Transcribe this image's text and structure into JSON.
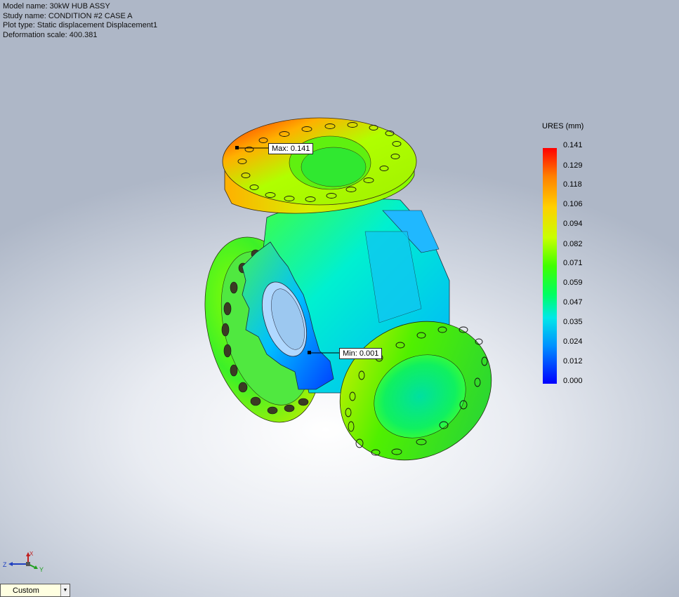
{
  "info": {
    "model_name": "Model name: 30kW HUB ASSY",
    "study_name": "Study name: CONDITION #2 CASE A",
    "plot_type": "Plot type: Static displacement Displacement1",
    "deformation_scale": "Deformation scale: 400.381"
  },
  "probes": {
    "max_label": "Max: 0.141",
    "min_label": "Min: 0.001"
  },
  "legend": {
    "title": "URES (mm)",
    "ticks": [
      "0.141",
      "0.129",
      "0.118",
      "0.106",
      "0.094",
      "0.082",
      "0.071",
      "0.059",
      "0.047",
      "0.035",
      "0.024",
      "0.012",
      "0.000"
    ]
  },
  "triad": {
    "x_label": "X",
    "y_label": "Y",
    "z_label": "Z"
  },
  "view_selector": {
    "value": "Custom"
  },
  "colors": {
    "max": "#ff0000",
    "min": "#0000ff",
    "background_top": "#aeb7c7",
    "background_center": "#ffffff"
  }
}
